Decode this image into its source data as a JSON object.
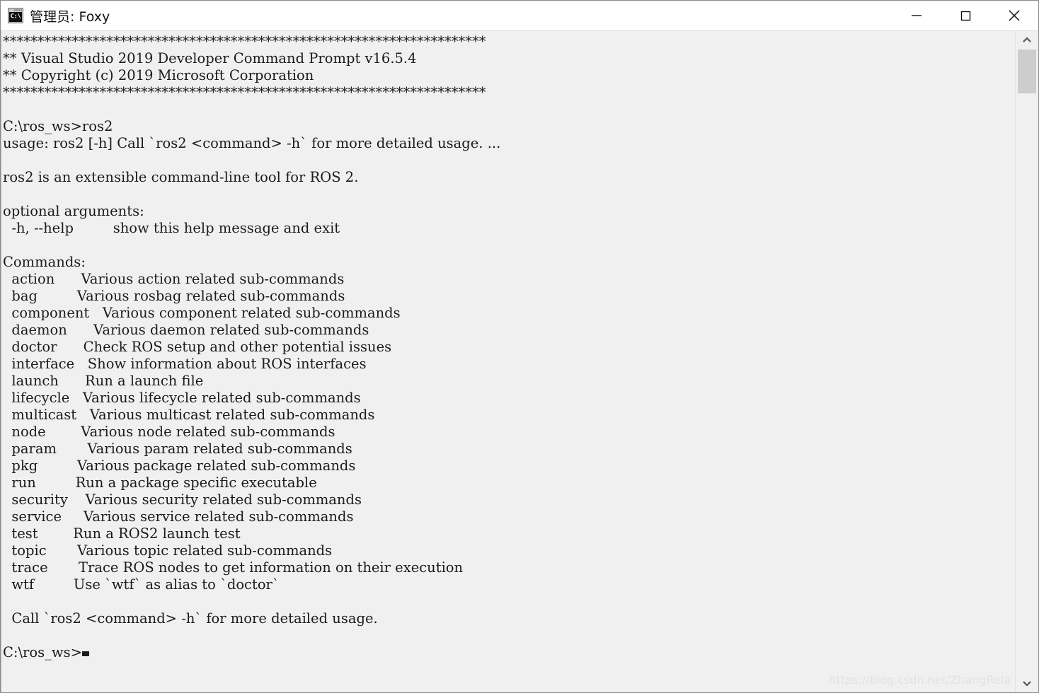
{
  "window": {
    "title": "管理员: Foxy",
    "icon_name": "cmd-icon",
    "icon_text": "C:\\",
    "controls": [
      {
        "name": "minimize-button",
        "label": "Minimize"
      },
      {
        "name": "maximize-button",
        "label": "Maximize"
      },
      {
        "name": "close-button",
        "label": "Close"
      }
    ]
  },
  "terminal": {
    "background_color": "#f0f0f0",
    "foreground_color": "#1b1b1b",
    "lines": [
      "**********************************************************************",
      "** Visual Studio 2019 Developer Command Prompt v16.5.4",
      "** Copyright (c) 2019 Microsoft Corporation",
      "**********************************************************************",
      "",
      "C:\\ros_ws>ros2",
      "usage: ros2 [-h] Call `ros2 <command> -h` for more detailed usage. ...",
      "",
      "ros2 is an extensible command-line tool for ROS 2.",
      "",
      "optional arguments:",
      "  -h, --help         show this help message and exit",
      "",
      "Commands:",
      "  action      Various action related sub-commands",
      "  bag         Various rosbag related sub-commands",
      "  component   Various component related sub-commands",
      "  daemon      Various daemon related sub-commands",
      "  doctor      Check ROS setup and other potential issues",
      "  interface   Show information about ROS interfaces",
      "  launch      Run a launch file",
      "  lifecycle   Various lifecycle related sub-commands",
      "  multicast   Various multicast related sub-commands",
      "  node        Various node related sub-commands",
      "  param       Various param related sub-commands",
      "  pkg         Various package related sub-commands",
      "  run         Run a package specific executable",
      "  security    Various security related sub-commands",
      "  service     Various service related sub-commands",
      "  test        Run a ROS2 launch test",
      "  topic       Various topic related sub-commands",
      "  trace       Trace ROS nodes to get information on their execution",
      "  wtf         Use `wtf` as alias to `doctor`",
      "",
      "  Call `ros2 <command> -h` for more detailed usage.",
      ""
    ],
    "prompt": "C:\\ros_ws>",
    "cursor": "block",
    "watermark": "https://blog.csdn.net/ZhangRela"
  },
  "scrollbar": {
    "up_arrow": "scroll-up-arrow",
    "down_arrow": "scroll-down-arrow",
    "thumb": "scroll-thumb"
  }
}
